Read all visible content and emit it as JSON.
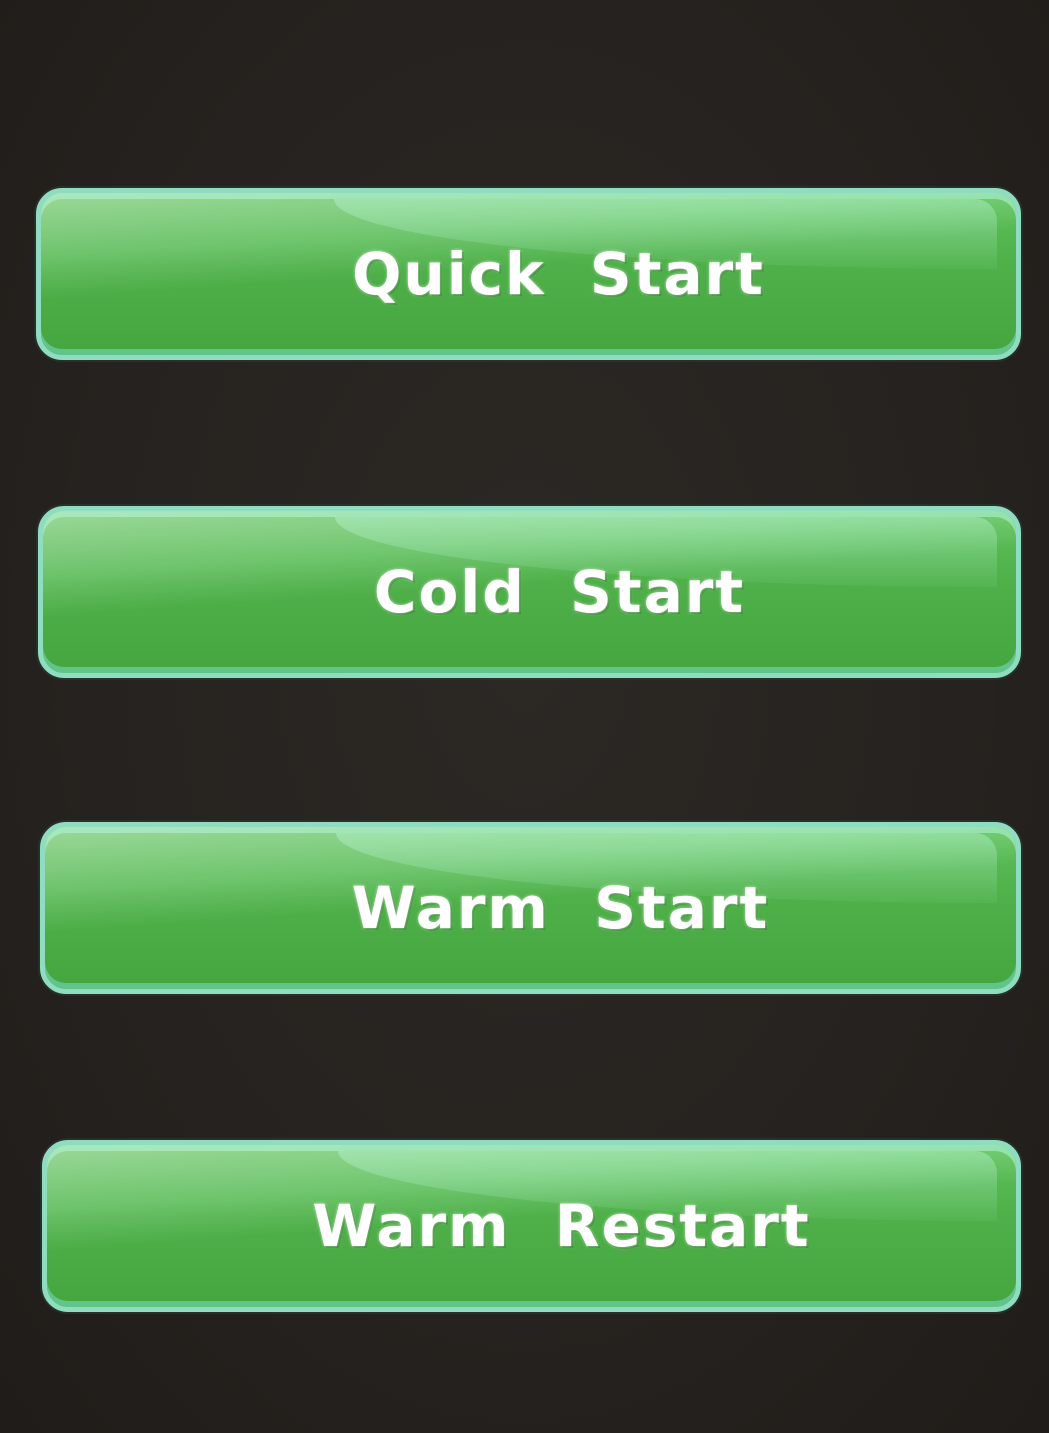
{
  "menu": {
    "items": [
      {
        "label": "Quick  Start"
      },
      {
        "label": "Cold  Start"
      },
      {
        "label": "Warm  Start"
      },
      {
        "label": "Warm  Restart"
      }
    ]
  },
  "colors": {
    "background": "#2a2622",
    "button_fill": "#4fb049",
    "button_border": "#8fdcc0",
    "label_text": "#ffffff"
  }
}
